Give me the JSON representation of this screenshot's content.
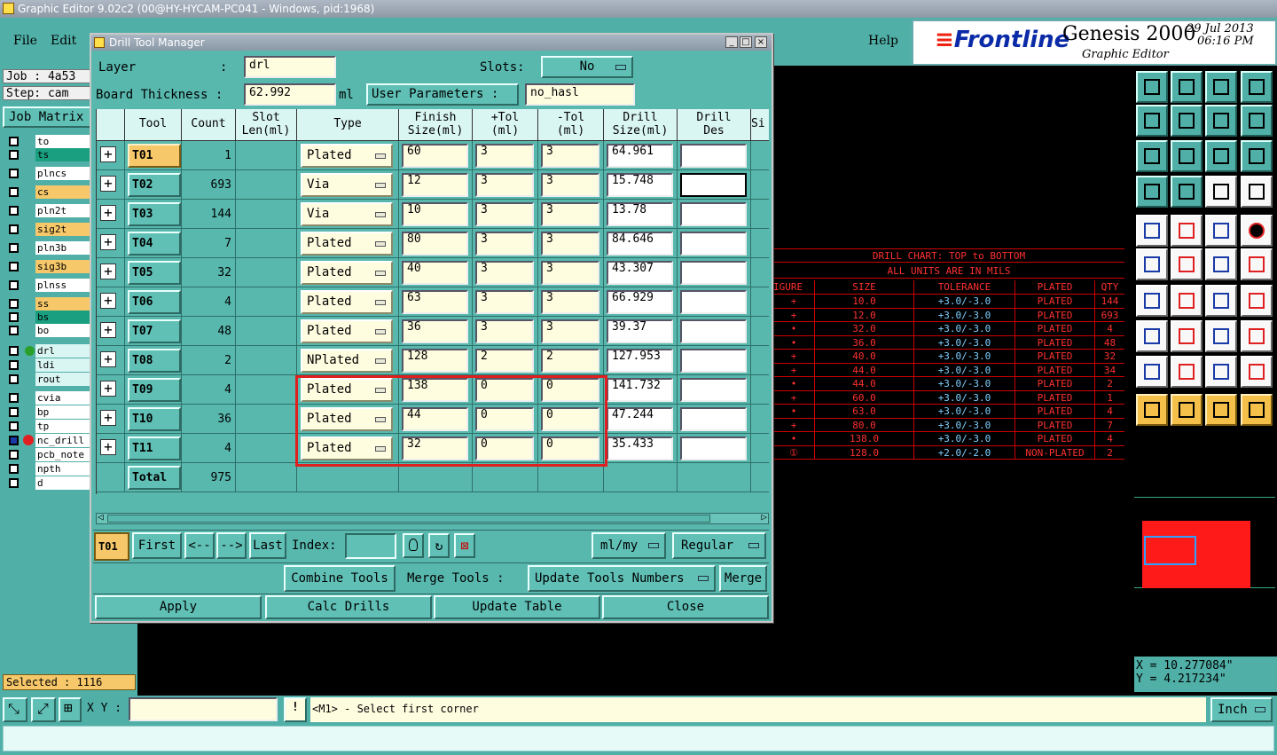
{
  "app_title": "Graphic Editor 9.02c2 (00@HY-HYCAM-PC041 - Windows, pid:1968)",
  "menu": {
    "file": "File",
    "edit": "Edit",
    "help": "Help"
  },
  "logo": {
    "brand": "Frontline",
    "product": "Genesis 2000",
    "subtitle": "Graphic Editor",
    "date": "29 Jul 2013",
    "time": "06:16 PM"
  },
  "left_panel": {
    "job": "Job : 4a53",
    "step": "Step: cam",
    "job_matrix": "Job Matrix",
    "layers": [
      "to",
      "ts",
      "plncs",
      "cs",
      "pln2t",
      "sig2t",
      "pln3b",
      "sig3b",
      "plnss",
      "ss",
      "bs",
      "bo",
      "drl",
      "ldi",
      "rout",
      "cvia",
      "bp",
      "tp",
      "nc_drill",
      "pcb_note",
      "npth",
      "d"
    ],
    "selected": "Selected : 1116"
  },
  "dialog": {
    "title": "Drill Tool Manager",
    "layer_label": "Layer",
    "layer_colon": ":",
    "layer_value": "drl",
    "slots_label": "Slots:",
    "slots_value": "No",
    "board_thickness_label": "Board Thickness :",
    "board_thickness_value": "62.992",
    "board_thickness_unit": "ml",
    "user_params_label": "User Parameters :",
    "user_params_value": "no_hasl",
    "columns": {
      "tool": "Tool",
      "count": "Count",
      "slot1": "Slot",
      "slot2": "Len(ml)",
      "type": "Type",
      "fin1": "Finish",
      "fin2": "Size(ml)",
      "ptol1": "+Tol",
      "ptol2": "(ml)",
      "mtol1": "-Tol",
      "mtol2": "(ml)",
      "drill1": "Drill",
      "drill2": "Size(ml)",
      "des1": "Drill",
      "des2": "Des",
      "si": "Si"
    },
    "rows": [
      {
        "tool": "T01",
        "count": "1",
        "type": "Plated",
        "finish": "60",
        "ptol": "3",
        "mtol": "3",
        "drill": "64.961"
      },
      {
        "tool": "T02",
        "count": "693",
        "type": "Via",
        "finish": "12",
        "ptol": "3",
        "mtol": "3",
        "drill": "15.748"
      },
      {
        "tool": "T03",
        "count": "144",
        "type": "Via",
        "finish": "10",
        "ptol": "3",
        "mtol": "3",
        "drill": "13.78"
      },
      {
        "tool": "T04",
        "count": "7",
        "type": "Plated",
        "finish": "80",
        "ptol": "3",
        "mtol": "3",
        "drill": "84.646"
      },
      {
        "tool": "T05",
        "count": "32",
        "type": "Plated",
        "finish": "40",
        "ptol": "3",
        "mtol": "3",
        "drill": "43.307"
      },
      {
        "tool": "T06",
        "count": "4",
        "type": "Plated",
        "finish": "63",
        "ptol": "3",
        "mtol": "3",
        "drill": "66.929"
      },
      {
        "tool": "T07",
        "count": "48",
        "type": "Plated",
        "finish": "36",
        "ptol": "3",
        "mtol": "3",
        "drill": "39.37"
      },
      {
        "tool": "T08",
        "count": "2",
        "type": "NPlated",
        "finish": "128",
        "ptol": "2",
        "mtol": "2",
        "drill": "127.953"
      },
      {
        "tool": "T09",
        "count": "4",
        "type": "Plated",
        "finish": "138",
        "ptol": "0",
        "mtol": "0",
        "drill": "141.732"
      },
      {
        "tool": "T10",
        "count": "36",
        "type": "Plated",
        "finish": "44",
        "ptol": "0",
        "mtol": "0",
        "drill": "47.244"
      },
      {
        "tool": "T11",
        "count": "4",
        "type": "Plated",
        "finish": "32",
        "ptol": "0",
        "mtol": "0",
        "drill": "35.433"
      }
    ],
    "total_label": "Total",
    "total_value": "975",
    "nav": {
      "current": "T01",
      "first": "First",
      "prev": "<--",
      "next": "-->",
      "last": "Last",
      "index": "Index:",
      "units": "ml/my",
      "mode": "Regular"
    },
    "combine_tools": "Combine Tools",
    "merge_tools": "Merge Tools :",
    "update_tools_numbers": "Update Tools Numbers",
    "merge": "Merge",
    "apply": "Apply",
    "calc_drills": "Calc Drills",
    "update_table": "Update Table",
    "close": "Close"
  },
  "drill_chart": {
    "title": "DRILL CHART: TOP to BOTTOM",
    "subtitle": "ALL UNITS ARE IN MILS",
    "headers": [
      "IGURE",
      "SIZE",
      "TOLERANCE",
      "PLATED",
      "QTY"
    ],
    "rows": [
      [
        "10.0",
        "+3.0/-3.0",
        "PLATED",
        "144"
      ],
      [
        "12.0",
        "+3.0/-3.0",
        "PLATED",
        "693"
      ],
      [
        "32.0",
        "+3.0/-3.0",
        "PLATED",
        "4"
      ],
      [
        "36.0",
        "+3.0/-3.0",
        "PLATED",
        "48"
      ],
      [
        "40.0",
        "+3.0/-3.0",
        "PLATED",
        "32"
      ],
      [
        "44.0",
        "+3.0/-3.0",
        "PLATED",
        "34"
      ],
      [
        "44.0",
        "+3.0/-3.0",
        "PLATED",
        "2"
      ],
      [
        "60.0",
        "+3.0/-3.0",
        "PLATED",
        "1"
      ],
      [
        "63.0",
        "+3.0/-3.0",
        "PLATED",
        "4"
      ],
      [
        "80.0",
        "+3.0/-3.0",
        "PLATED",
        "7"
      ],
      [
        "138.0",
        "+3.0/-3.0",
        "PLATED",
        "4"
      ],
      [
        "128.0",
        "+2.0/-2.0",
        "NON-PLATED",
        "2"
      ]
    ]
  },
  "coords": {
    "x": "X = 10.277084\"",
    "y": "Y = 4.217234\""
  },
  "status": {
    "xy_label": "X Y :",
    "message": "<M1> - Select first corner",
    "unit": "Inch",
    "warn": "!"
  },
  "colors": {
    "teal": "#50b0a8",
    "highlight": "#e02020",
    "tool_button": "#f6c86a",
    "chart_red": "#ff3030"
  }
}
